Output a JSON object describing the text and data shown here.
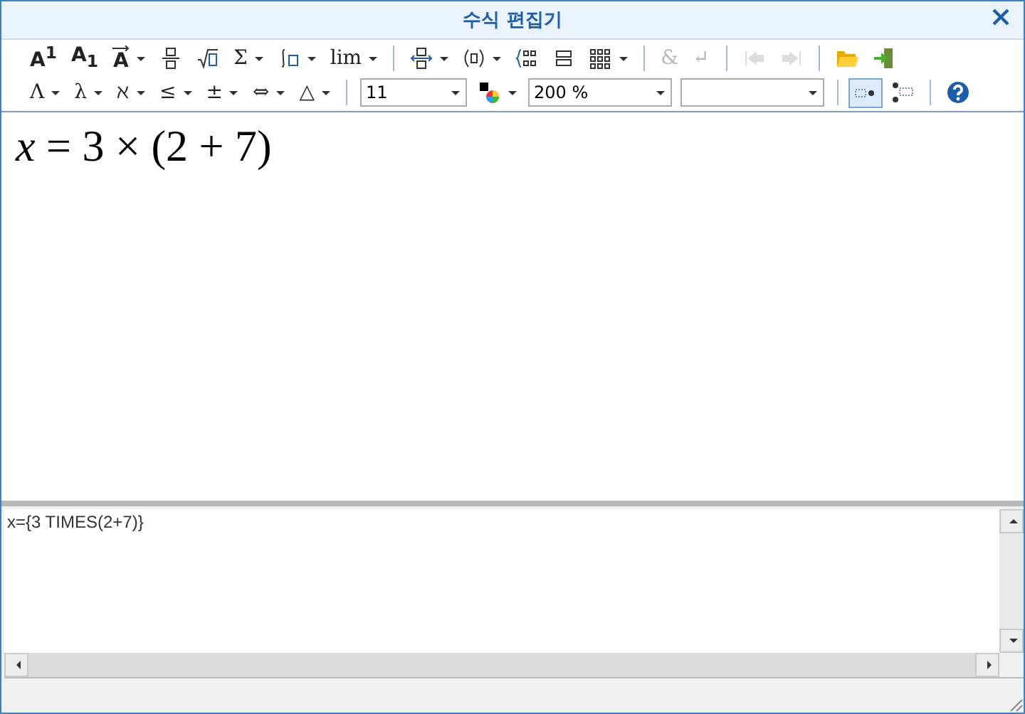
{
  "window": {
    "title": "수식 편집기"
  },
  "toolbar_rows": [
    [
      {
        "kind": "glyph",
        "text": "A$^{1}$",
        "dropdown": false,
        "disabled": false
      },
      {
        "kind": "glyph",
        "text": "A$_{1}$",
        "dropdown": false,
        "disabled": false
      },
      {
        "kind": "vector",
        "text": "A",
        "dropdown": true,
        "disabled": false
      },
      {
        "kind": "fraction",
        "dropdown": false,
        "disabled": false
      },
      {
        "kind": "root",
        "dropdown": false,
        "disabled": false
      },
      {
        "kind": "glyph",
        "text": "Σ",
        "dropdown": true,
        "disabled": false
      },
      {
        "kind": "integral",
        "dropdown": true,
        "disabled": false
      },
      {
        "kind": "glyph",
        "text": "lim",
        "dropdown": true,
        "disabled": false
      },
      {
        "kind": "separator"
      },
      {
        "kind": "arrows",
        "dropdown": true,
        "disabled": false
      },
      {
        "kind": "paren",
        "dropdown": true,
        "disabled": false
      },
      {
        "kind": "brace",
        "dropdown": false,
        "disabled": false
      },
      {
        "kind": "stack",
        "dropdown": false,
        "disabled": false
      },
      {
        "kind": "grid",
        "dropdown": true,
        "disabled": false
      },
      {
        "kind": "separator"
      },
      {
        "kind": "glyph",
        "text": "&",
        "dropdown": false,
        "disabled": true
      },
      {
        "kind": "glyph",
        "text": "↵",
        "dropdown": false,
        "disabled": true
      },
      {
        "kind": "separator"
      },
      {
        "kind": "prev",
        "dropdown": false,
        "disabled": true
      },
      {
        "kind": "next",
        "dropdown": false,
        "disabled": true
      },
      {
        "kind": "separator"
      },
      {
        "kind": "folder",
        "dropdown": false,
        "disabled": false
      },
      {
        "kind": "exit",
        "dropdown": false,
        "disabled": false
      }
    ],
    [
      {
        "kind": "glyph",
        "text": "Λ",
        "dropdown": true,
        "disabled": false
      },
      {
        "kind": "glyph",
        "text": "λ",
        "dropdown": true,
        "disabled": false
      },
      {
        "kind": "glyph",
        "text": "ℵ",
        "dropdown": true,
        "disabled": false
      },
      {
        "kind": "glyph",
        "text": "≤",
        "dropdown": true,
        "disabled": false
      },
      {
        "kind": "glyph",
        "text": "±",
        "dropdown": true,
        "disabled": false
      },
      {
        "kind": "glyph",
        "text": "⇔",
        "dropdown": true,
        "disabled": false
      },
      {
        "kind": "glyph",
        "text": "△",
        "dropdown": true,
        "disabled": false
      },
      {
        "kind": "separator"
      },
      {
        "kind": "size-combo",
        "value": "11"
      },
      {
        "kind": "color",
        "dropdown": true,
        "disabled": false
      },
      {
        "kind": "zoom-combo",
        "value": "200 %"
      },
      {
        "kind": "font-combo"
      },
      {
        "kind": "separator"
      },
      {
        "kind": "inline-toggle",
        "selected": true,
        "disabled": false
      },
      {
        "kind": "stack-toggle",
        "selected": false,
        "disabled": false
      },
      {
        "kind": "separator"
      },
      {
        "kind": "help",
        "disabled": false
      }
    ]
  ],
  "formula": "*x* = 3 × (2 + 7)",
  "script": {
    "value": "x={3 TIMES(2+7)}"
  }
}
